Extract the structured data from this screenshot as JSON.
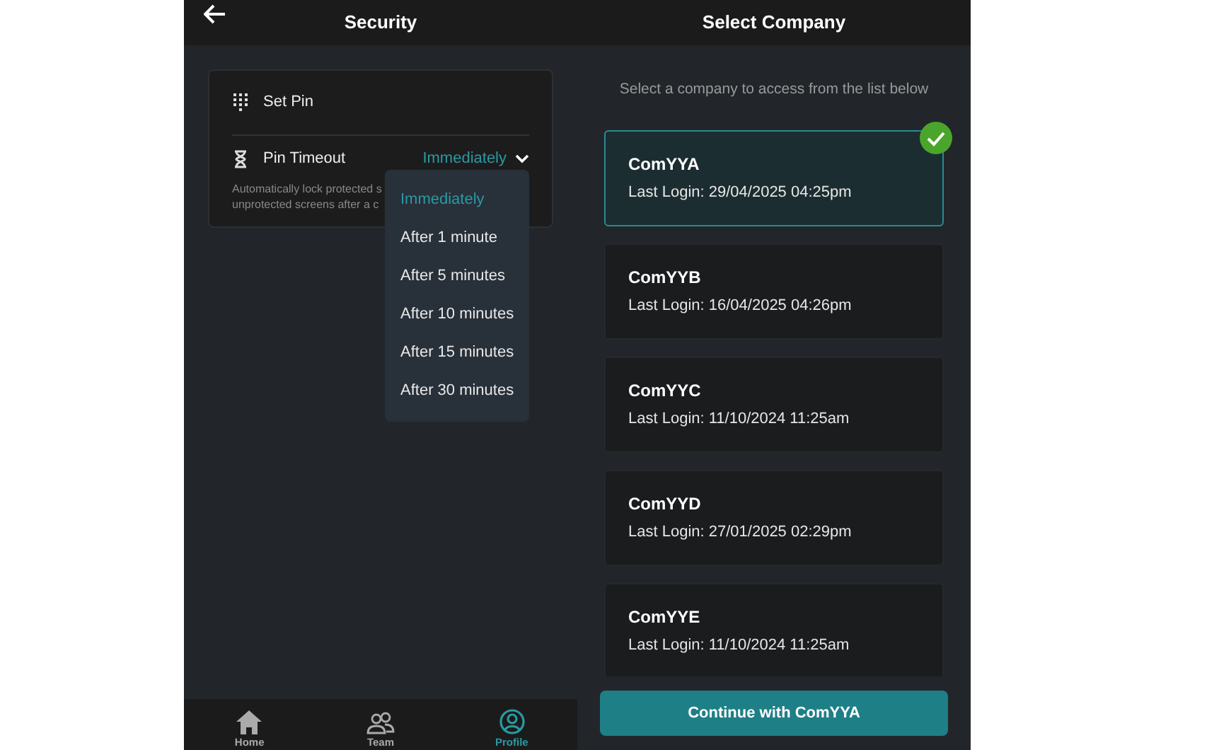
{
  "security": {
    "title": "Security",
    "items": [
      {
        "kind": "pin",
        "label": "Set Pin"
      },
      {
        "kind": "timeout",
        "label": "Pin Timeout",
        "value": "Immediately",
        "description": [
          "Automatically lock protected s",
          "unprotected screens after a c"
        ]
      }
    ],
    "dropdown": [
      {
        "label": "Immediately",
        "selected": true
      },
      {
        "label": "After 1 minute",
        "selected": false
      },
      {
        "label": "After 5 minutes",
        "selected": false
      },
      {
        "label": "After 10 minutes",
        "selected": false
      },
      {
        "label": "After 15 minutes",
        "selected": false
      },
      {
        "label": "After 30 minutes",
        "selected": false
      }
    ],
    "nav": [
      {
        "kind": "home",
        "label": "Home",
        "selected": false
      },
      {
        "kind": "team",
        "label": "Team",
        "selected": false
      },
      {
        "kind": "profile",
        "label": "Profile",
        "selected": true
      }
    ]
  },
  "company": {
    "title": "Select Company",
    "subtitle": "Select a company to access from the list below",
    "companies": [
      {
        "name": "ComYYA",
        "last_login": "Last Login: 29/04/2025 04:25pm",
        "selected": true
      },
      {
        "name": "ComYYB",
        "last_login": "Last Login: 16/04/2025 04:26pm",
        "selected": false
      },
      {
        "name": "ComYYC",
        "last_login": "Last Login: 11/10/2024 11:25am",
        "selected": false
      },
      {
        "name": "ComYYD",
        "last_login": "Last Login: 27/01/2025 02:29pm",
        "selected": false
      },
      {
        "name": "ComYYE",
        "last_login": "Last Login: 11/10/2024 11:25am",
        "selected": false
      }
    ],
    "button": "Continue with ComYYA"
  }
}
